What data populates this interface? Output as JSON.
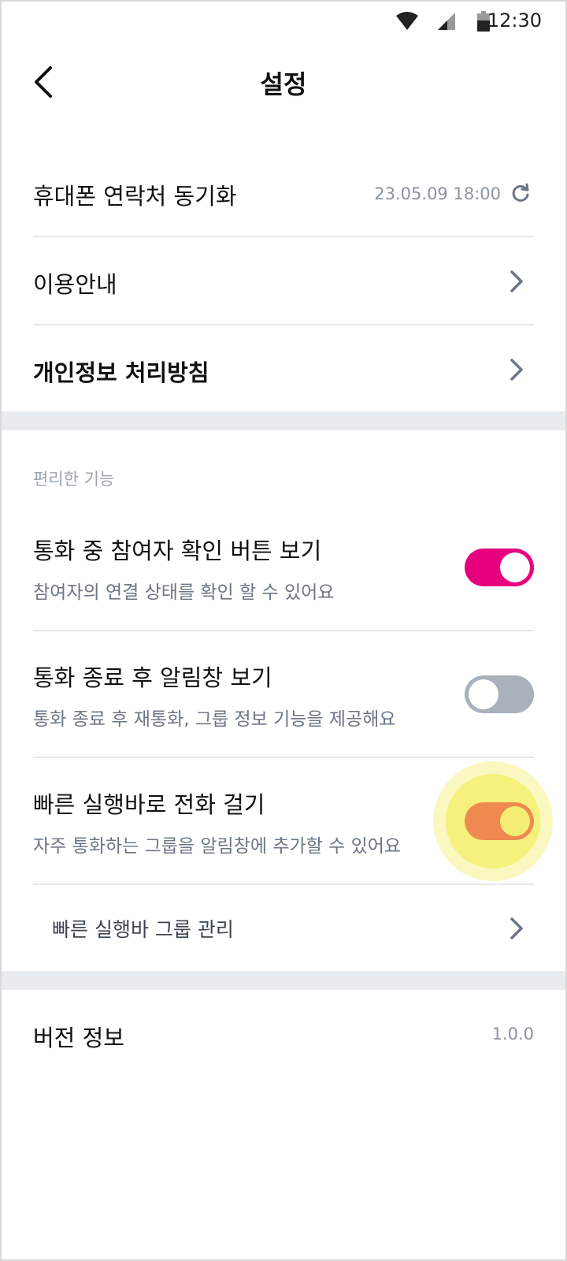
{
  "status_bar": {
    "time": "12:30",
    "icons": [
      "wifi-icon",
      "signal-icon",
      "battery-icon"
    ]
  },
  "header": {
    "title": "설정",
    "back_icon": "back-arrow-icon"
  },
  "account_items": [
    {
      "label": "휴대폰 연락처 동기화",
      "value": "23.05.09 18:00",
      "icon": "refresh-icon"
    },
    {
      "label": "이용안내",
      "icon": "chevron-right-icon"
    },
    {
      "label": "개인정보 처리방침",
      "icon": "chevron-right-icon"
    }
  ],
  "features": {
    "section_title": "편리한 기능",
    "items": [
      {
        "label": "통화 중 참여자 확인 버튼 보기",
        "description": "참여자의 연결 상태를 확인 할 수 있어요",
        "enabled": true
      },
      {
        "label": "통화 종료 후 알림창 보기",
        "description": "통화 종료 후 재통화, 그룹 정보 기능을 제공해요",
        "enabled": false
      },
      {
        "label": "빠른 실행바로 전화 걸기",
        "description": "자주 통화하는 그룹을 알림창에 추가할 수 있어요",
        "enabled": true
      }
    ],
    "sub_item": {
      "label": "빠른 실행바 그룹 관리",
      "icon": "chevron-right-icon"
    }
  },
  "version": {
    "label": "버전 정보",
    "value": "1.0.0"
  },
  "colors": {
    "toggle_on": "#e6007e",
    "toggle_off": "#a9b1bb",
    "highlight": "#f4ef74"
  }
}
